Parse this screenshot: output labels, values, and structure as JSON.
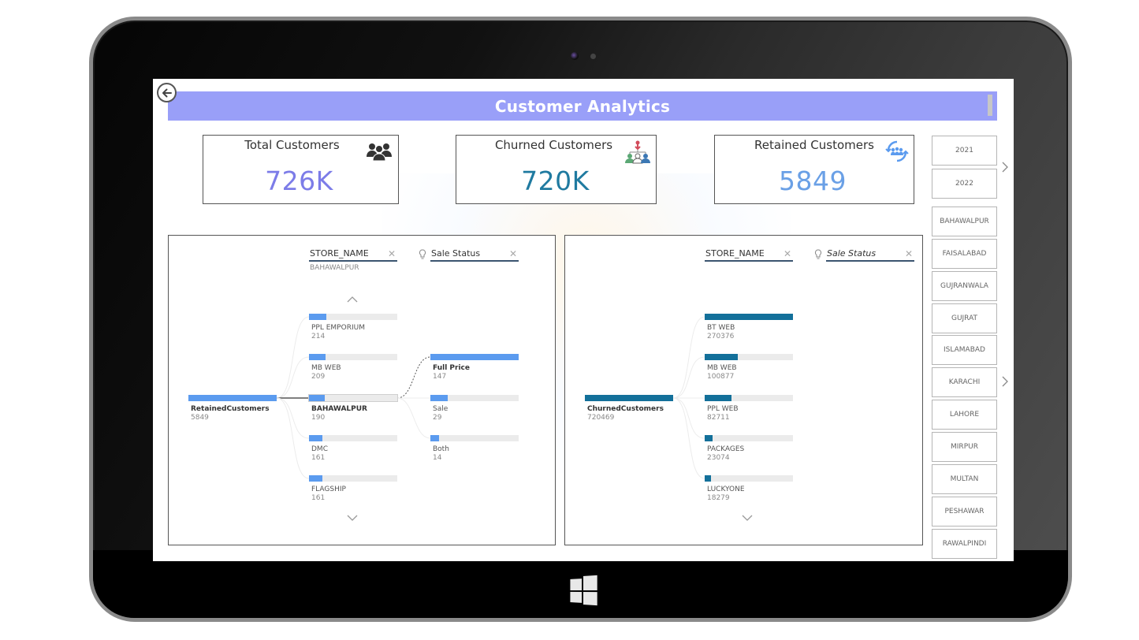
{
  "device": {
    "type": "tablet",
    "home_button_icon": "windows-logo-icon"
  },
  "report": {
    "title": "Customer Analytics",
    "back_icon": "back-arrow-icon",
    "colors": {
      "title_bar": "#999ff8",
      "retained_accent": "#5b9bef",
      "churned_accent": "#13709a",
      "total_value": "#7c7ce8",
      "churned_value": "#1f7aa0",
      "retained_value": "#6aa0e6"
    }
  },
  "kpis": [
    {
      "label": "Total Customers",
      "value": "726K",
      "icon": "people-group-icon"
    },
    {
      "label": "Churned Customers",
      "value": "720K",
      "icon": "churn-people-icon"
    },
    {
      "label": "Retained Customers",
      "value": "5849",
      "icon": "retention-cycle-icon"
    }
  ],
  "slicers": {
    "years": [
      "2021",
      "2022"
    ],
    "cities": [
      "BAHAWALPUR",
      "FAISALABAD",
      "GUJRANWALA",
      "GUJRAT",
      "ISLAMABAD",
      "KARACHI",
      "LAHORE",
      "MIRPUR",
      "MULTAN",
      "PESHAWAR",
      "RAWALPINDI"
    ]
  },
  "decomposition_trees": [
    {
      "id": "retained",
      "levels": [
        {
          "label": "STORE_NAME",
          "ai_split": false,
          "italic": false,
          "filter": "BAHAWALPUR"
        },
        {
          "label": "Sale Status",
          "ai_split": true,
          "italic": false,
          "filter": ""
        }
      ],
      "root": {
        "label": "RetainedCustomers",
        "value": "5849",
        "fraction": 1.0
      },
      "level1_nodes": [
        {
          "label": "PPL EMPORIUM",
          "value": "214",
          "fraction": 0.2,
          "selected": false
        },
        {
          "label": "MB WEB",
          "value": "209",
          "fraction": 0.19,
          "selected": false
        },
        {
          "label": "BAHAWALPUR",
          "value": "190",
          "fraction": 0.18,
          "selected": true
        },
        {
          "label": "DMC",
          "value": "161",
          "fraction": 0.15,
          "selected": false
        },
        {
          "label": "FLAGSHIP",
          "value": "161",
          "fraction": 0.15,
          "selected": false
        }
      ],
      "level2_nodes": [
        {
          "label": "Full Price",
          "value": "147",
          "fraction": 1.0,
          "selected": true
        },
        {
          "label": "Sale",
          "value": "29",
          "fraction": 0.2,
          "selected": false
        },
        {
          "label": "Both",
          "value": "14",
          "fraction": 0.095,
          "selected": false
        }
      ],
      "has_scroll_up": true,
      "has_scroll_down": true
    },
    {
      "id": "churned",
      "levels": [
        {
          "label": "STORE_NAME",
          "ai_split": false,
          "italic": false,
          "filter": ""
        },
        {
          "label": "Sale Status",
          "ai_split": true,
          "italic": true,
          "filter": ""
        }
      ],
      "root": {
        "label": "ChurnedCustomers",
        "value": "720469",
        "fraction": 1.0
      },
      "level1_nodes": [
        {
          "label": "BT WEB",
          "value": "270376",
          "fraction": 1.0,
          "selected": false
        },
        {
          "label": "MB WEB",
          "value": "100877",
          "fraction": 0.373,
          "selected": false
        },
        {
          "label": "PPL WEB",
          "value": "82711",
          "fraction": 0.306,
          "selected": false
        },
        {
          "label": "PACKAGES",
          "value": "23074",
          "fraction": 0.085,
          "selected": false
        },
        {
          "label": "LUCKYONE",
          "value": "18279",
          "fraction": 0.068,
          "selected": false
        }
      ],
      "level2_nodes": [],
      "has_scroll_up": false,
      "has_scroll_down": true
    }
  ]
}
